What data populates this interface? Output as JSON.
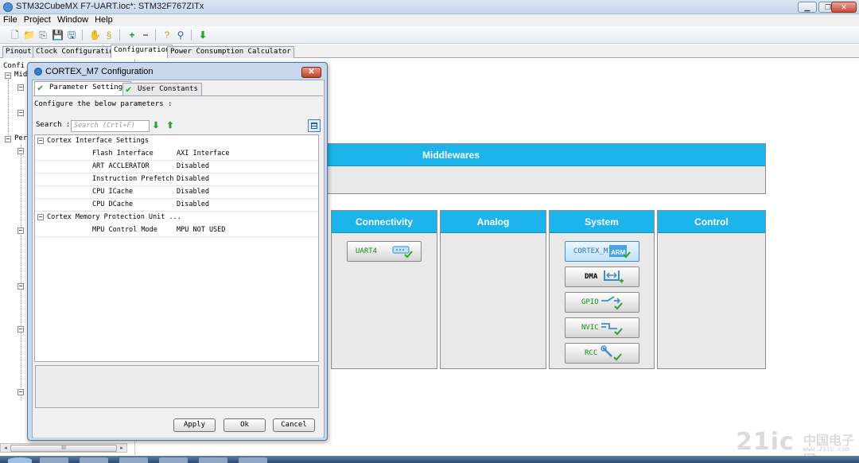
{
  "window": {
    "title": "STM32CubeMX F7-UART.ioc*: STM32F767ZITx"
  },
  "menu": [
    "File",
    "Project",
    "Window",
    "Help"
  ],
  "tabs": [
    "Pinout",
    "Clock Configuration",
    "Configuration",
    "Power Consumption Calculator"
  ],
  "active_tab": "Configuration",
  "tree": {
    "items": [
      "Confi",
      "Mid",
      "Per"
    ]
  },
  "scrollbar": {
    "thumb_label": "III"
  },
  "canvas": {
    "middlewares": "Middlewares",
    "columns": [
      "Connectivity",
      "Analog",
      "System",
      "Control"
    ],
    "connectivity_items": [
      "UART4"
    ],
    "system_items": [
      "CORTEX_M7",
      "DMA",
      "GPIO",
      "NVIC",
      "RCC"
    ],
    "arm_badge": "ARM"
  },
  "dialog": {
    "title": "CORTEX_M7 Configuration",
    "tabs": [
      "Parameter Settings",
      "User Constants"
    ],
    "instruction": "Configure the below parameters :",
    "search_label": "Search :",
    "search_placeholder": "Search (Crtl+F)",
    "groups": [
      {
        "name": "Cortex Interface Settings",
        "params": [
          {
            "k": "Flash Interface",
            "v": "AXI Interface"
          },
          {
            "k": "ART ACCLERATOR",
            "v": "Disabled"
          },
          {
            "k": "Instruction Prefetch",
            "v": "Disabled"
          },
          {
            "k": "CPU ICache",
            "v": "Disabled"
          },
          {
            "k": "CPU DCache",
            "v": "Disabled"
          }
        ]
      },
      {
        "name": "Cortex Memory Protection Unit ...",
        "params": [
          {
            "k": "MPU Control Mode",
            "v": "MPU NOT USED"
          }
        ]
      }
    ],
    "buttons": {
      "apply": "Apply",
      "ok": "Ok",
      "cancel": "Cancel"
    }
  },
  "watermark": {
    "logo": "21ic",
    "cn": "中国电子网",
    "url": "www.21ic.com"
  },
  "colors": {
    "header_blue": "#1cb4ea",
    "panel_gray": "#e9e9e9",
    "ok_green": "#2aa52a"
  }
}
